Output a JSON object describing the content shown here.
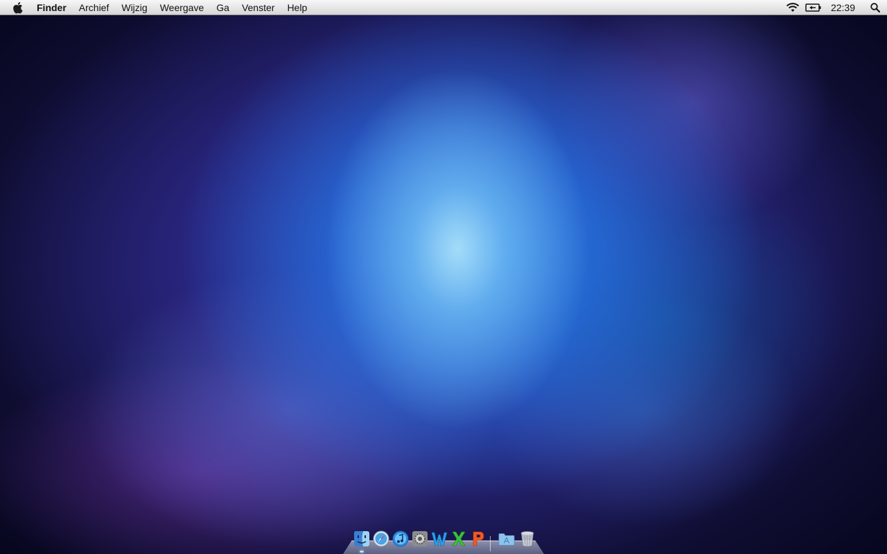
{
  "menubar": {
    "app_name": "Finder",
    "menus": [
      "Archief",
      "Wijzig",
      "Weergave",
      "Ga",
      "Venster",
      "Help"
    ],
    "clock": "22:39",
    "status_icons": [
      "wifi-icon",
      "battery-icon",
      "spotlight-search-icon"
    ]
  },
  "dock": {
    "items": [
      {
        "name": "Finder",
        "icon": "finder-icon",
        "running": true
      },
      {
        "name": "Safari",
        "icon": "safari-icon",
        "running": false
      },
      {
        "name": "iTunes",
        "icon": "itunes-icon",
        "running": false
      },
      {
        "name": "Systeemvoorkeuren",
        "icon": "system-preferences-icon",
        "running": false
      },
      {
        "name": "Word",
        "icon": "word-icon",
        "running": false
      },
      {
        "name": "Excel",
        "icon": "excel-icon",
        "running": false
      },
      {
        "name": "PowerPoint",
        "icon": "powerpoint-icon",
        "running": false
      },
      {
        "name": "Programma's",
        "icon": "applications-folder-icon",
        "running": false
      },
      {
        "name": "Prullenmand",
        "icon": "trash-icon",
        "running": false
      }
    ]
  },
  "colors": {
    "menubar_bg": "#e6e6e6",
    "wallpaper_center": "#8fd0f5",
    "wallpaper_edge": "#05051a"
  }
}
